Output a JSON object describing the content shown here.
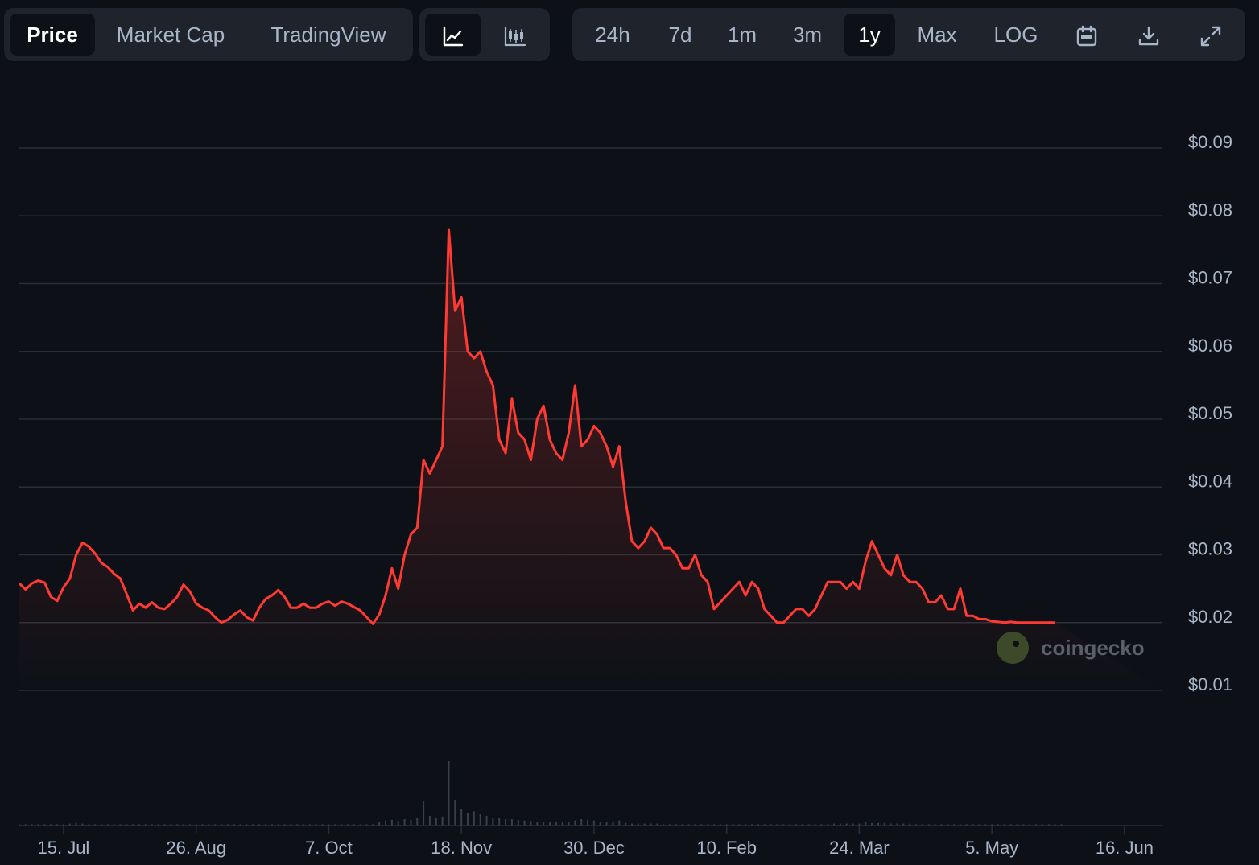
{
  "tabs": {
    "price": "Price",
    "market_cap": "Market Cap",
    "tradingview": "TradingView"
  },
  "chart_type_buttons": {
    "line": "line-chart-icon",
    "candle": "candlestick-chart-icon"
  },
  "ranges": {
    "h24": "24h",
    "d7": "7d",
    "m1": "1m",
    "m3": "3m",
    "y1": "1y",
    "max": "Max",
    "log": "LOG"
  },
  "active_tab": "Price",
  "active_range": "1y",
  "actions": {
    "calendar": "calendar-icon",
    "download": "download-icon",
    "fullscreen": "expand-icon"
  },
  "watermark": "coingecko",
  "colors": {
    "line": "#ff3a33",
    "background": "#0d1117",
    "grid": "#2a2f37",
    "volume": "#3a4049"
  },
  "chart_data": {
    "type": "line",
    "y_tick_labels": [
      "$0.09",
      "$0.08",
      "$0.07",
      "$0.06",
      "$0.05",
      "$0.04",
      "$0.03",
      "$0.02",
      "$0.01"
    ],
    "y_ticks": [
      0.09,
      0.08,
      0.07,
      0.06,
      0.05,
      0.04,
      0.03,
      0.02,
      0.01
    ],
    "ylim": [
      0.01,
      0.09
    ],
    "x_tick_labels": [
      "15. Jul",
      "26. Aug",
      "7. Oct",
      "18. Nov",
      "30. Dec",
      "10. Feb",
      "24. Mar",
      "5. May",
      "16. Jun"
    ],
    "x_tick_days": [
      14,
      56,
      98,
      140,
      182,
      224,
      266,
      308,
      350
    ],
    "x_days": [
      0,
      2,
      4,
      6,
      8,
      10,
      12,
      14,
      16,
      18,
      20,
      22,
      24,
      26,
      28,
      30,
      32,
      34,
      36,
      38,
      40,
      42,
      44,
      46,
      48,
      50,
      52,
      54,
      56,
      58,
      60,
      62,
      64,
      66,
      68,
      70,
      72,
      74,
      76,
      78,
      80,
      82,
      84,
      86,
      88,
      90,
      92,
      94,
      96,
      98,
      100,
      102,
      104,
      106,
      108,
      110,
      112,
      114,
      116,
      118,
      120,
      122,
      124,
      126,
      128,
      130,
      132,
      134,
      136,
      138,
      140,
      142,
      144,
      146,
      148,
      150,
      152,
      154,
      156,
      158,
      160,
      162,
      164,
      166,
      168,
      170,
      172,
      174,
      176,
      178,
      180,
      182,
      184,
      186,
      188,
      190,
      192,
      194,
      196,
      198,
      200,
      202,
      204,
      206,
      208,
      210,
      212,
      214,
      216,
      218,
      220,
      222,
      224,
      226,
      228,
      230,
      232,
      234,
      236,
      238,
      240,
      242,
      244,
      246,
      248,
      250,
      252,
      254,
      256,
      258,
      260,
      262,
      264,
      266,
      268,
      270,
      272,
      274,
      276,
      278,
      280,
      282,
      284,
      286,
      288,
      290,
      292,
      294,
      296,
      298,
      300,
      302,
      304,
      306,
      308,
      310,
      312,
      314,
      316,
      318,
      320,
      322,
      324,
      326,
      328,
      330,
      332,
      334,
      336,
      338,
      340,
      342,
      344,
      346,
      348,
      350,
      352,
      354,
      356,
      358,
      360,
      362
    ],
    "price": [
      0.0258,
      0.0249,
      0.0258,
      0.0262,
      0.0259,
      0.0238,
      0.0232,
      0.0252,
      0.0265,
      0.03,
      0.0318,
      0.0312,
      0.0302,
      0.0288,
      0.0282,
      0.0272,
      0.0265,
      0.0242,
      0.0218,
      0.0228,
      0.0222,
      0.023,
      0.0222,
      0.022,
      0.0228,
      0.0238,
      0.0256,
      0.0246,
      0.0228,
      0.0222,
      0.0218,
      0.0208,
      0.02,
      0.0204,
      0.0212,
      0.0218,
      0.0208,
      0.0203,
      0.0222,
      0.0235,
      0.024,
      0.0248,
      0.0238,
      0.0222,
      0.0222,
      0.0228,
      0.0222,
      0.0222,
      0.0228,
      0.0231,
      0.0225,
      0.0231,
      0.0228,
      0.0223,
      0.0218,
      0.0208,
      0.0198,
      0.0212,
      0.024,
      0.028,
      0.025,
      0.03,
      0.033,
      0.034,
      0.044,
      0.042,
      0.044,
      0.046,
      0.078,
      0.066,
      0.068,
      0.06,
      0.059,
      0.06,
      0.057,
      0.055,
      0.047,
      0.045,
      0.053,
      0.048,
      0.047,
      0.044,
      0.05,
      0.052,
      0.047,
      0.045,
      0.044,
      0.048,
      0.055,
      0.046,
      0.047,
      0.049,
      0.048,
      0.046,
      0.043,
      0.046,
      0.038,
      0.032,
      0.031,
      0.032,
      0.034,
      0.033,
      0.031,
      0.031,
      0.03,
      0.028,
      0.028,
      0.03,
      0.027,
      0.026,
      0.022,
      0.023,
      0.024,
      0.025,
      0.026,
      0.024,
      0.026,
      0.025,
      0.022,
      0.021,
      0.02,
      0.02,
      0.021,
      0.022,
      0.022,
      0.021,
      0.022,
      0.024,
      0.026,
      0.026,
      0.026,
      0.025,
      0.026,
      0.025,
      0.029,
      0.032,
      0.03,
      0.028,
      0.027,
      0.03,
      0.027,
      0.026,
      0.026,
      0.025,
      0.023,
      0.023,
      0.024,
      0.022,
      0.022,
      0.025,
      0.021,
      0.021,
      0.0205,
      0.0205,
      0.0202,
      0.0201,
      0.02,
      0.0201,
      0.02,
      0.02,
      0.02,
      0.02,
      0.02,
      0.02,
      0.02
    ],
    "volume_relative": [
      0.02,
      0.02,
      0.02,
      0.02,
      0.02,
      0.02,
      0.02,
      0.02,
      0.03,
      0.04,
      0.03,
      0.02,
      0.02,
      0.02,
      0.02,
      0.02,
      0.02,
      0.02,
      0.02,
      0.02,
      0.02,
      0.02,
      0.02,
      0.02,
      0.02,
      0.02,
      0.02,
      0.02,
      0.02,
      0.02,
      0.02,
      0.02,
      0.02,
      0.02,
      0.02,
      0.02,
      0.02,
      0.02,
      0.02,
      0.02,
      0.02,
      0.02,
      0.02,
      0.02,
      0.02,
      0.02,
      0.02,
      0.02,
      0.02,
      0.02,
      0.02,
      0.02,
      0.02,
      0.02,
      0.02,
      0.02,
      0.02,
      0.05,
      0.08,
      0.09,
      0.07,
      0.1,
      0.09,
      0.12,
      0.38,
      0.15,
      0.12,
      0.14,
      1.0,
      0.4,
      0.25,
      0.2,
      0.22,
      0.18,
      0.15,
      0.12,
      0.12,
      0.1,
      0.1,
      0.09,
      0.08,
      0.07,
      0.06,
      0.06,
      0.05,
      0.05,
      0.05,
      0.05,
      0.08,
      0.1,
      0.09,
      0.08,
      0.06,
      0.05,
      0.05,
      0.08,
      0.04,
      0.03,
      0.03,
      0.03,
      0.03,
      0.03,
      0.02,
      0.02,
      0.02,
      0.02,
      0.02,
      0.02,
      0.02,
      0.02,
      0.02,
      0.02,
      0.02,
      0.02,
      0.02,
      0.02,
      0.02,
      0.02,
      0.02,
      0.02,
      0.02,
      0.02,
      0.02,
      0.02,
      0.02,
      0.02,
      0.02,
      0.02,
      0.02,
      0.03,
      0.03,
      0.03,
      0.03,
      0.03,
      0.05,
      0.04,
      0.04,
      0.04,
      0.03,
      0.03,
      0.03,
      0.03,
      0.02,
      0.02,
      0.02,
      0.02,
      0.02,
      0.02,
      0.02,
      0.02,
      0.02,
      0.02,
      0.02,
      0.02,
      0.02,
      0.02,
      0.02,
      0.02,
      0.02,
      0.02,
      0.02,
      0.02,
      0.02,
      0.02,
      0.02,
      0.02
    ],
    "grid": true
  }
}
